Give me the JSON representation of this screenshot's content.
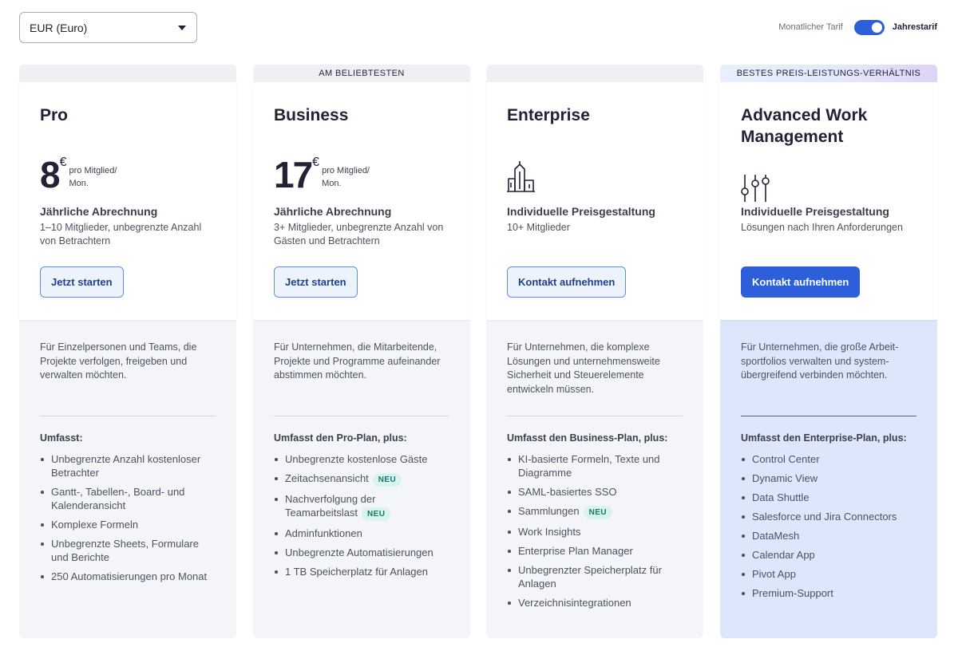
{
  "currency": {
    "selected": "EUR (Euro)"
  },
  "billing": {
    "monthly_label": "Monatlicher Tarif",
    "annual_label": "Jahrestarif",
    "annual_selected": true
  },
  "colors": {
    "primary": "#2c5fd9",
    "badge_text": "#16786a",
    "badge_bg": "#d9f4ee",
    "highlight_bg": "#dde6fb"
  },
  "plans": [
    {
      "banner": "",
      "title": "Pro",
      "price": {
        "amount": "8",
        "currency": "€",
        "per": "pro Mitglied/ Mon."
      },
      "billing": "Jährliche Abrechnung",
      "desc": "1–10 Mitglieder, unbegrenzte Anzahl von Betrachtern",
      "button": "Jetzt starten",
      "intro": "Für Einzelpersonen und Teams, die Projekte verfolgen, freigeben und verwalten möchten.",
      "features_heading": "Umfasst:",
      "features": [
        {
          "text": "Unbegrenzte Anzahl kostenloser Betrachter",
          "badge": ""
        },
        {
          "text": "Gantt-, Tabellen-, Board- und Kalenderansicht",
          "badge": ""
        },
        {
          "text": "Komplexe Formeln",
          "badge": ""
        },
        {
          "text": "Unbegrenzte Sheets, Formulare und Berichte",
          "badge": ""
        },
        {
          "text": "250 Automatisierungen pro Monat",
          "badge": ""
        }
      ]
    },
    {
      "banner": "AM BELIEBTESTEN",
      "title": "Business",
      "price": {
        "amount": "17",
        "currency": "€",
        "per": "pro Mitglied/ Mon."
      },
      "billing": "Jährliche Abrechnung",
      "desc": "3+ Mitglieder, unbegrenzte Anzahl von Gästen und Betrachtern",
      "button": "Jetzt starten",
      "intro": "Für Unternehmen, die Mitarbeitende, Projekte und Programme aufeinander abstimmen möchten.",
      "features_heading": "Umfasst den Pro-Plan, plus:",
      "features": [
        {
          "text": "Unbegrenzte kostenlose Gäste",
          "badge": ""
        },
        {
          "text": "Zeitachsenansicht",
          "badge": "NEU"
        },
        {
          "text": "Nachverfolgung der Teamarbeitslast",
          "badge": "NEU"
        },
        {
          "text": "Adminfunktionen",
          "badge": ""
        },
        {
          "text": "Unbegrenzte Automatisierungen",
          "badge": ""
        },
        {
          "text": "1 TB Speicherplatz für Anlagen",
          "badge": ""
        }
      ]
    },
    {
      "banner": "",
      "title": "Enterprise",
      "icon": "buildings-icon",
      "billing": "Individuelle Preisgestaltung",
      "desc": "10+ Mitglieder",
      "button": "Kontakt aufnehmen",
      "intro": "Für Unternehmen, die komplexe Lösungen und unternehmensweite Sicherheit und Steuerelemente entwickeln müssen.",
      "features_heading": "Umfasst den Business-Plan, plus:",
      "features": [
        {
          "text": "KI-basierte Formeln, Texte und Diagramme",
          "badge": ""
        },
        {
          "text": "SAML-basiertes SSO",
          "badge": ""
        },
        {
          "text": "Sammlungen",
          "badge": "NEU"
        },
        {
          "text": "Work Insights",
          "badge": ""
        },
        {
          "text": "Enterprise Plan Manager",
          "badge": ""
        },
        {
          "text": "Unbegrenzter Speicherplatz für Anlagen",
          "badge": ""
        },
        {
          "text": "Verzeichnisintegrationen",
          "badge": ""
        }
      ]
    },
    {
      "banner": "BESTES PREIS-LEISTUNGS-VERHÄLTNIS",
      "title": "Advanced Work Management",
      "icon": "sliders-icon",
      "billing": "Individuelle Preisgestaltung",
      "desc": "Lösungen nach Ihren Anforderungen",
      "button": "Kontakt aufnehmen",
      "intro": "Für Unternehmen, die große Arbeit­sportfolios verwalten und system­übergreifend verbinden möchten.",
      "features_heading": "Umfasst den Enterprise-Plan, plus:",
      "features": [
        {
          "text": "Control Center",
          "badge": ""
        },
        {
          "text": "Dynamic View",
          "badge": ""
        },
        {
          "text": "Data Shuttle",
          "badge": ""
        },
        {
          "text": "Salesforce und Jira Connectors",
          "badge": ""
        },
        {
          "text": "DataMesh",
          "badge": ""
        },
        {
          "text": "Calendar App",
          "badge": ""
        },
        {
          "text": "Pivot App",
          "badge": ""
        },
        {
          "text": "Premium-Support",
          "badge": ""
        }
      ]
    }
  ]
}
